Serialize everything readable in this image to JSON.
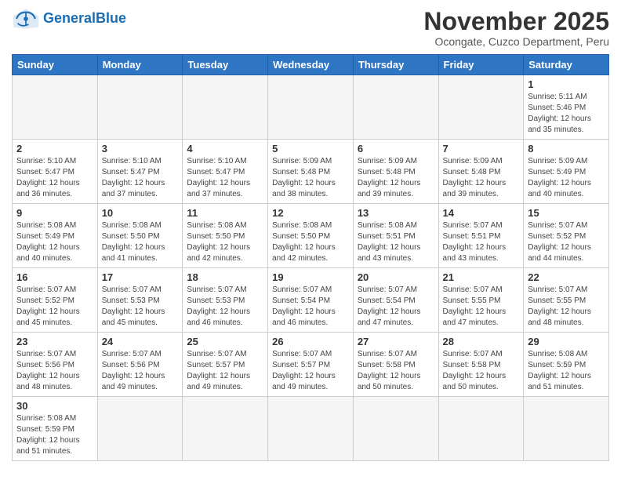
{
  "header": {
    "logo_general": "General",
    "logo_blue": "Blue",
    "month_title": "November 2025",
    "subtitle": "Ocongate, Cuzco Department, Peru"
  },
  "days_of_week": [
    "Sunday",
    "Monday",
    "Tuesday",
    "Wednesday",
    "Thursday",
    "Friday",
    "Saturday"
  ],
  "weeks": [
    [
      {
        "day": "",
        "info": "",
        "empty": true
      },
      {
        "day": "",
        "info": "",
        "empty": true
      },
      {
        "day": "",
        "info": "",
        "empty": true
      },
      {
        "day": "",
        "info": "",
        "empty": true
      },
      {
        "day": "",
        "info": "",
        "empty": true
      },
      {
        "day": "",
        "info": "",
        "empty": true
      },
      {
        "day": "1",
        "info": "Sunrise: 5:11 AM\nSunset: 5:46 PM\nDaylight: 12 hours and 35 minutes."
      }
    ],
    [
      {
        "day": "2",
        "info": "Sunrise: 5:10 AM\nSunset: 5:47 PM\nDaylight: 12 hours and 36 minutes."
      },
      {
        "day": "3",
        "info": "Sunrise: 5:10 AM\nSunset: 5:47 PM\nDaylight: 12 hours and 37 minutes."
      },
      {
        "day": "4",
        "info": "Sunrise: 5:10 AM\nSunset: 5:47 PM\nDaylight: 12 hours and 37 minutes."
      },
      {
        "day": "5",
        "info": "Sunrise: 5:09 AM\nSunset: 5:48 PM\nDaylight: 12 hours and 38 minutes."
      },
      {
        "day": "6",
        "info": "Sunrise: 5:09 AM\nSunset: 5:48 PM\nDaylight: 12 hours and 39 minutes."
      },
      {
        "day": "7",
        "info": "Sunrise: 5:09 AM\nSunset: 5:48 PM\nDaylight: 12 hours and 39 minutes."
      },
      {
        "day": "8",
        "info": "Sunrise: 5:09 AM\nSunset: 5:49 PM\nDaylight: 12 hours and 40 minutes."
      }
    ],
    [
      {
        "day": "9",
        "info": "Sunrise: 5:08 AM\nSunset: 5:49 PM\nDaylight: 12 hours and 40 minutes."
      },
      {
        "day": "10",
        "info": "Sunrise: 5:08 AM\nSunset: 5:50 PM\nDaylight: 12 hours and 41 minutes."
      },
      {
        "day": "11",
        "info": "Sunrise: 5:08 AM\nSunset: 5:50 PM\nDaylight: 12 hours and 42 minutes."
      },
      {
        "day": "12",
        "info": "Sunrise: 5:08 AM\nSunset: 5:50 PM\nDaylight: 12 hours and 42 minutes."
      },
      {
        "day": "13",
        "info": "Sunrise: 5:08 AM\nSunset: 5:51 PM\nDaylight: 12 hours and 43 minutes."
      },
      {
        "day": "14",
        "info": "Sunrise: 5:07 AM\nSunset: 5:51 PM\nDaylight: 12 hours and 43 minutes."
      },
      {
        "day": "15",
        "info": "Sunrise: 5:07 AM\nSunset: 5:52 PM\nDaylight: 12 hours and 44 minutes."
      }
    ],
    [
      {
        "day": "16",
        "info": "Sunrise: 5:07 AM\nSunset: 5:52 PM\nDaylight: 12 hours and 45 minutes."
      },
      {
        "day": "17",
        "info": "Sunrise: 5:07 AM\nSunset: 5:53 PM\nDaylight: 12 hours and 45 minutes."
      },
      {
        "day": "18",
        "info": "Sunrise: 5:07 AM\nSunset: 5:53 PM\nDaylight: 12 hours and 46 minutes."
      },
      {
        "day": "19",
        "info": "Sunrise: 5:07 AM\nSunset: 5:54 PM\nDaylight: 12 hours and 46 minutes."
      },
      {
        "day": "20",
        "info": "Sunrise: 5:07 AM\nSunset: 5:54 PM\nDaylight: 12 hours and 47 minutes."
      },
      {
        "day": "21",
        "info": "Sunrise: 5:07 AM\nSunset: 5:55 PM\nDaylight: 12 hours and 47 minutes."
      },
      {
        "day": "22",
        "info": "Sunrise: 5:07 AM\nSunset: 5:55 PM\nDaylight: 12 hours and 48 minutes."
      }
    ],
    [
      {
        "day": "23",
        "info": "Sunrise: 5:07 AM\nSunset: 5:56 PM\nDaylight: 12 hours and 48 minutes."
      },
      {
        "day": "24",
        "info": "Sunrise: 5:07 AM\nSunset: 5:56 PM\nDaylight: 12 hours and 49 minutes."
      },
      {
        "day": "25",
        "info": "Sunrise: 5:07 AM\nSunset: 5:57 PM\nDaylight: 12 hours and 49 minutes."
      },
      {
        "day": "26",
        "info": "Sunrise: 5:07 AM\nSunset: 5:57 PM\nDaylight: 12 hours and 49 minutes."
      },
      {
        "day": "27",
        "info": "Sunrise: 5:07 AM\nSunset: 5:58 PM\nDaylight: 12 hours and 50 minutes."
      },
      {
        "day": "28",
        "info": "Sunrise: 5:07 AM\nSunset: 5:58 PM\nDaylight: 12 hours and 50 minutes."
      },
      {
        "day": "29",
        "info": "Sunrise: 5:08 AM\nSunset: 5:59 PM\nDaylight: 12 hours and 51 minutes."
      }
    ],
    [
      {
        "day": "30",
        "info": "Sunrise: 5:08 AM\nSunset: 5:59 PM\nDaylight: 12 hours and 51 minutes."
      },
      {
        "day": "",
        "info": "",
        "empty": true
      },
      {
        "day": "",
        "info": "",
        "empty": true
      },
      {
        "day": "",
        "info": "",
        "empty": true
      },
      {
        "day": "",
        "info": "",
        "empty": true
      },
      {
        "day": "",
        "info": "",
        "empty": true
      },
      {
        "day": "",
        "info": "",
        "empty": true
      }
    ]
  ]
}
